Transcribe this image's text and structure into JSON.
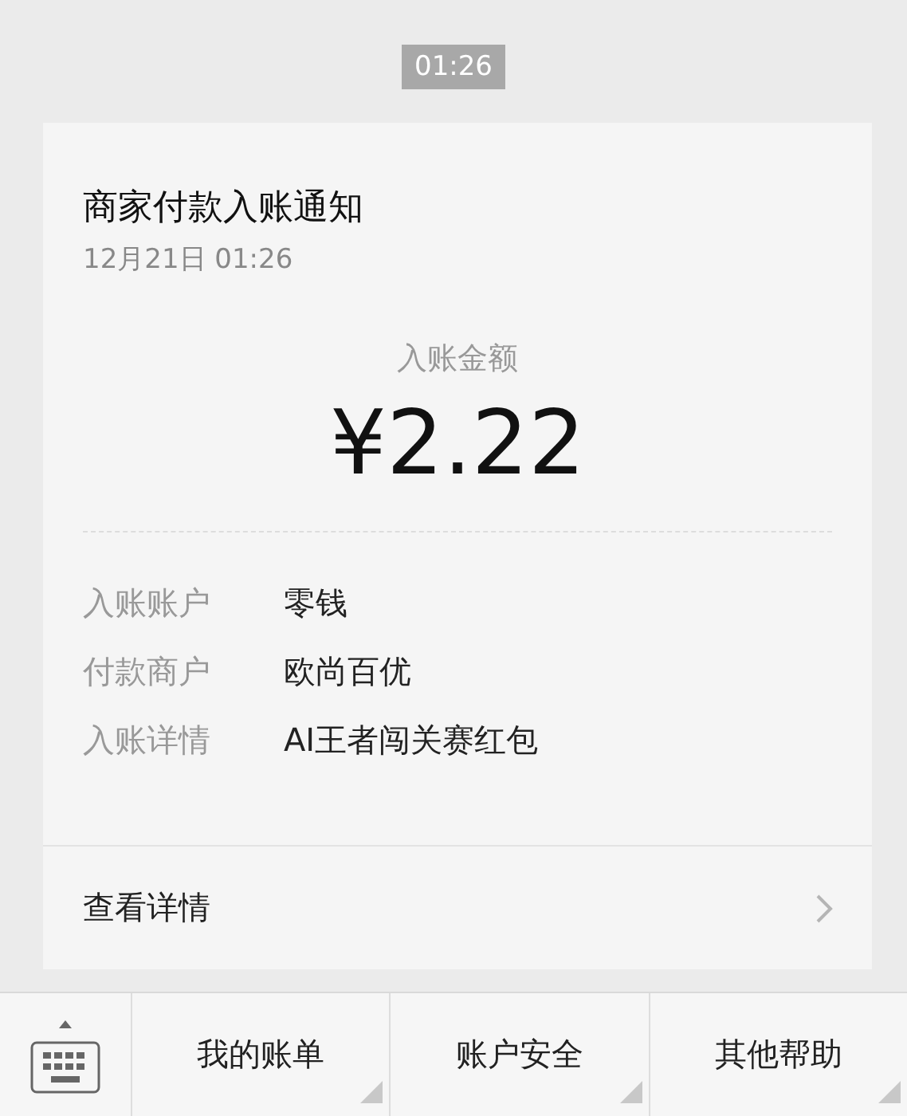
{
  "time_badge": "01:26",
  "card": {
    "title": "商家付款入账通知",
    "date": "12月21日  01:26",
    "amount_label": "入账金额",
    "amount": "¥2.22",
    "rows": [
      {
        "label": "入账账户",
        "value": "零钱"
      },
      {
        "label": "付款商户",
        "value": "欧尚百优"
      },
      {
        "label": "入账详情",
        "value": "AI王者闯关赛红包"
      }
    ],
    "details_link": "查看详情"
  },
  "menu": [
    "我的账单",
    "账户安全",
    "其他帮助"
  ]
}
